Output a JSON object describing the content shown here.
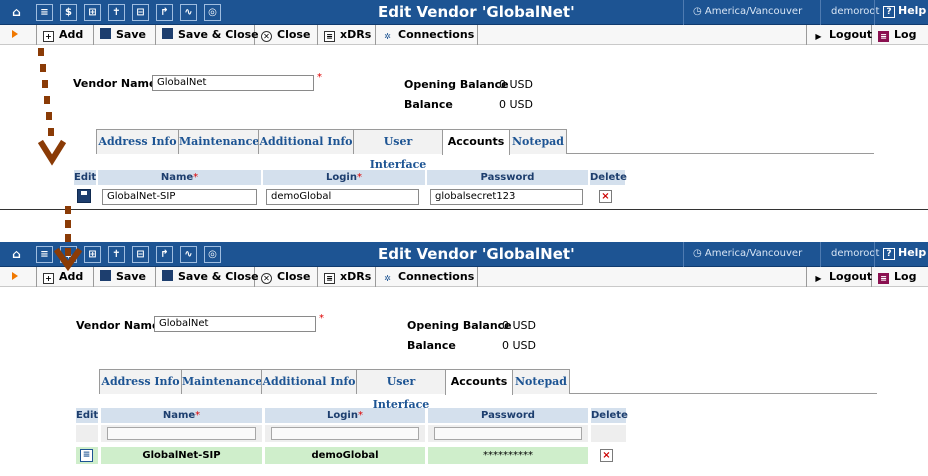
{
  "app": {
    "title": "Edit Vendor 'GlobalNet'",
    "timezone": "America/Vancouver",
    "user": "demoroot",
    "help_label": "Help",
    "help_icon": "question-icon"
  },
  "nav_icons": [
    "home-icon",
    "list-icon",
    "dollar-icon",
    "grid-icon",
    "person-icon",
    "network-icon",
    "routing-icon",
    "chart-icon",
    "search-icon"
  ],
  "toolbar": {
    "add": "Add",
    "save": "Save",
    "save_close": "Save & Close",
    "close": "Close",
    "xdrs": "xDRs",
    "connections": "Connections",
    "logout": "Logout",
    "log": "Log"
  },
  "form": {
    "vendor_name_label": "Vendor Name",
    "vendor_name_value": "GlobalNet",
    "required_mark": "*",
    "opening_balance_label": "Opening Balance",
    "opening_balance_value": "0 USD",
    "balance_label": "Balance",
    "balance_value": "0 USD"
  },
  "tabs": [
    "Address Info",
    "Maintenance",
    "Additional Info",
    "User Interface",
    "Accounts",
    "Notepad"
  ],
  "active_tab": "Accounts",
  "accounts_table": {
    "columns": {
      "edit": "Edit",
      "name": "Name",
      "login": "Login",
      "password": "Password",
      "delete": "Delete"
    },
    "edit_row": {
      "name": "GlobalNet-SIP",
      "login": "demoGlobal",
      "password": "globalsecret123"
    },
    "saved_row": {
      "name": "GlobalNet-SIP",
      "login": "demoGlobal",
      "password": "**********"
    },
    "delete_glyph": "×"
  },
  "colors": {
    "header_blue": "#1d5493",
    "row_green": "#cfeecb",
    "column_header": "#d4e0ed",
    "annotation_arrow": "#8a3b06"
  }
}
